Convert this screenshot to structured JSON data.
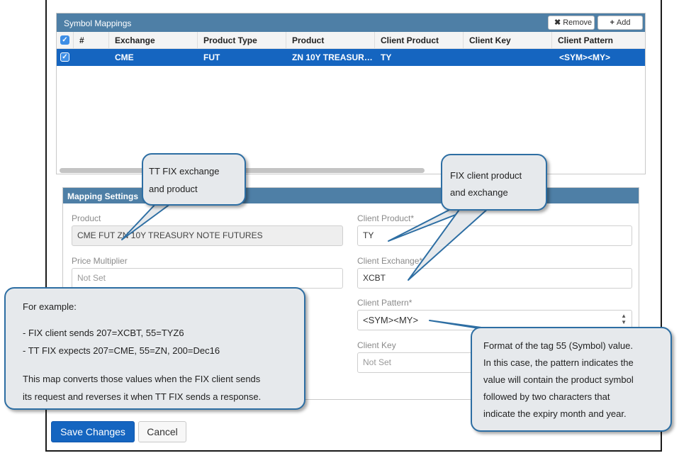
{
  "symbol_mappings": {
    "title": "Symbol Mappings",
    "remove_label": "Remove",
    "add_label": "Add",
    "columns": [
      "#",
      "Exchange",
      "Product Type",
      "Product",
      "Client Product",
      "Client Key",
      "Client Pattern"
    ],
    "rows": [
      {
        "number": "",
        "exchange": "CME",
        "product_type": "FUT",
        "product": "ZN 10Y TREASUR…",
        "client_product": "TY",
        "client_key": "",
        "client_pattern": "<SYM><MY>"
      }
    ]
  },
  "mapping_settings": {
    "title": "Mapping Settings",
    "product_label": "Product",
    "product_value": "CME FUT ZN 10Y TREASURY NOTE FUTURES",
    "price_multiplier_label": "Price Multiplier",
    "price_multiplier_placeholder": "Not Set",
    "client_product_label": "Client Product*",
    "client_product_value": "TY",
    "client_exchange_label": "Client Exchange*",
    "client_exchange_value": "XCBT",
    "client_pattern_label": "Client Pattern*",
    "client_pattern_value": "<SYM><MY>",
    "client_key_label": "Client Key",
    "client_key_placeholder": "Not Set"
  },
  "actions": {
    "save_label": "Save Changes",
    "cancel_label": "Cancel"
  },
  "callouts": {
    "tt_fix": [
      "TT FIX exchange",
      "and product"
    ],
    "fix_client": [
      "FIX client product",
      "and exchange"
    ],
    "example": [
      "For example:",
      "- FIX client sends 207=XCBT, 55=TYZ6",
      "- TT FIX expects 207=CME, 55=ZN, 200=Dec16",
      "This map converts those values when the FIX client sends",
      "its request and reverses it when TT FIX sends a response."
    ],
    "format": [
      "Format of the tag 55 (Symbol) value.",
      "In this case, the pattern indicates the",
      "value will contain the product symbol",
      "followed by two characters that",
      "indicate the expiry month and year."
    ]
  },
  "colors": {
    "panel_header": "#4e7fa6",
    "selected_row": "#1565c0",
    "callout_border": "#2d6ea3",
    "callout_fill": "#e6e9ec"
  }
}
